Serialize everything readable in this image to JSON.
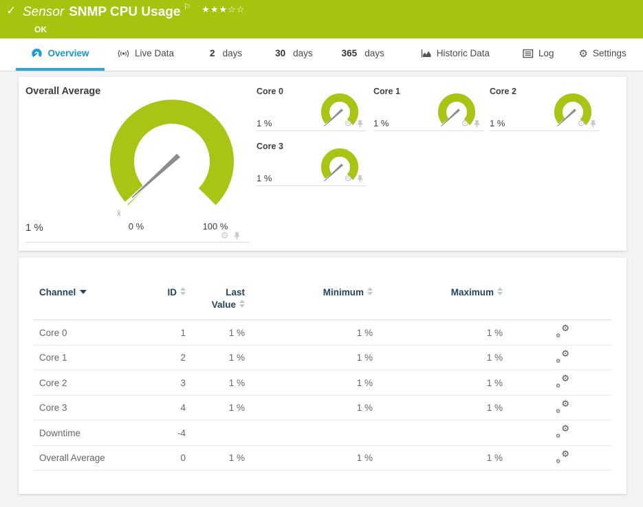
{
  "header": {
    "check_icon": "✓",
    "kind": "Sensor",
    "title": "SNMP CPU Usage",
    "flag_icon": "⚐",
    "stars_filled": "★★★",
    "stars_empty": "☆☆",
    "status": "OK"
  },
  "tabs": [
    {
      "label": "Overview"
    },
    {
      "label": "Live Data"
    },
    {
      "strong": "2",
      "label": "days"
    },
    {
      "strong": "30",
      "label": "days"
    },
    {
      "strong": "365",
      "label": "days"
    },
    {
      "label": "Historic Data"
    },
    {
      "label": "Log"
    },
    {
      "label": "Settings"
    }
  ],
  "overview": {
    "overall": {
      "label": "Overall Average",
      "value": "1 %",
      "min": "0 %",
      "max": "100 %",
      "mean_marker": "x̄"
    },
    "cores": [
      {
        "label": "Core 0",
        "value": "1 %"
      },
      {
        "label": "Core 1",
        "value": "1 %"
      },
      {
        "label": "Core 2",
        "value": "1 %"
      },
      {
        "label": "Core 3",
        "value": "1 %"
      }
    ],
    "gear_icon": "⚙"
  },
  "table": {
    "columns": {
      "channel": "Channel",
      "id": "ID",
      "last_line1": "Last",
      "last_line2": "Value",
      "minimum": "Minimum",
      "maximum": "Maximum"
    },
    "rows": [
      {
        "channel": "Core 0",
        "id": "1",
        "last": "1 %",
        "min": "1 %",
        "max": "1 %"
      },
      {
        "channel": "Core 1",
        "id": "2",
        "last": "1 %",
        "min": "1 %",
        "max": "1 %"
      },
      {
        "channel": "Core 2",
        "id": "3",
        "last": "1 %",
        "min": "1 %",
        "max": "1 %"
      },
      {
        "channel": "Core 3",
        "id": "4",
        "last": "1 %",
        "min": "1 %",
        "max": "1 %"
      },
      {
        "channel": "Downtime",
        "id": "-4",
        "last": "",
        "min": "",
        "max": ""
      },
      {
        "channel": "Overall Average",
        "id": "0",
        "last": "1 %",
        "min": "1 %",
        "max": "1 %"
      }
    ],
    "gear_icon": "⚙"
  },
  "colors": {
    "status_ok_green": "#a6c40e",
    "gauge_green": "#a9c415",
    "accent_blue": "#29a8dc",
    "table_header_text": "#26425c"
  }
}
